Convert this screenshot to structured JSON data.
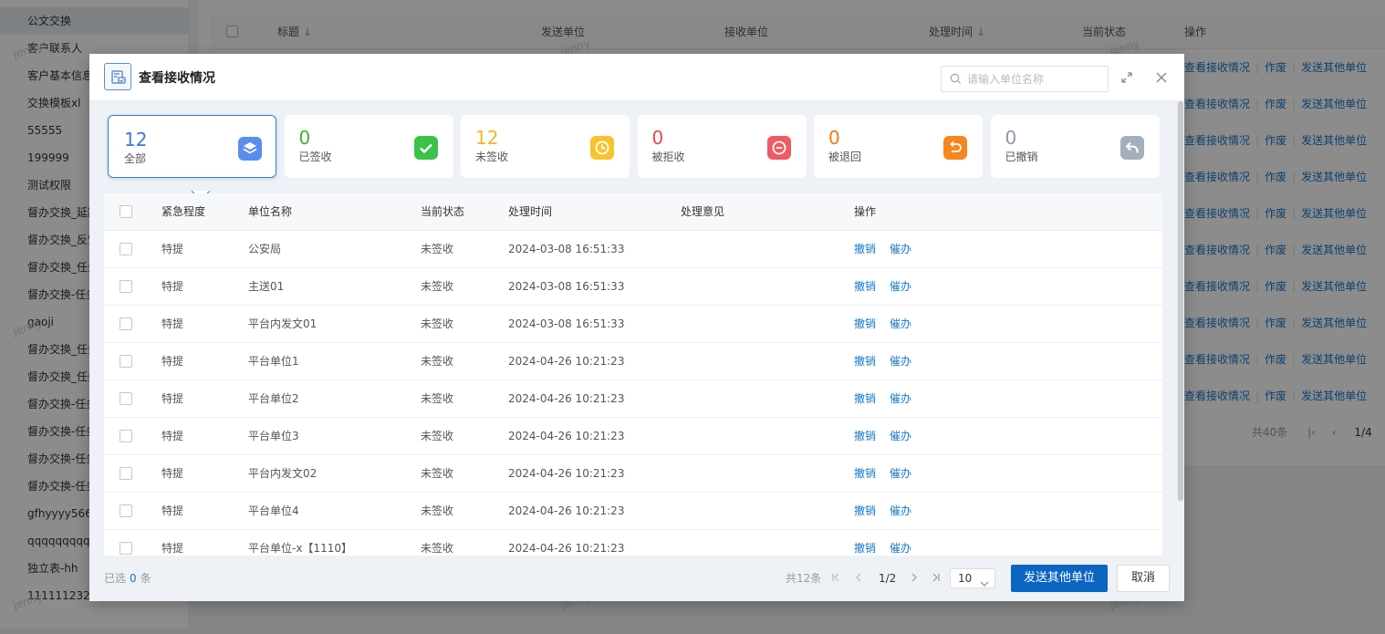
{
  "sidebar": {
    "items": [
      "公文交换",
      "客户联系人",
      "客户基本信息",
      "交换模板xl",
      "55555",
      "199999",
      "测试权限",
      "督办交换_延期",
      "督办交换_反馈",
      "督办交换_任务",
      "督办交换-任务",
      "gaoji",
      "督办交换_任务",
      "督办交换_任务",
      "督办交换-任务",
      "督办交换-任务",
      "督办交换-任务",
      "督办交换-任务",
      "gfhyyyy5666",
      "qqqqqqqqqqq",
      "独立表-hh",
      "11111123232"
    ]
  },
  "background_table": {
    "headers": {
      "title": "标题",
      "send_unit": "发送单位",
      "recv_unit": "接收单位",
      "time": "处理时间",
      "status": "当前状态",
      "ops": "操作"
    },
    "sort_arrow": "↓",
    "row_actions": [
      "查看接收情况",
      "作废",
      "发送其他单位"
    ],
    "row_count": 10,
    "pager": {
      "total": "共40条",
      "page": "1/4"
    }
  },
  "watermark": "jenny",
  "modal": {
    "title": "查看接收情况",
    "search_placeholder": "请输入单位名称",
    "cards": [
      {
        "count": "12",
        "label": "全部",
        "color": "#3a7bd5",
        "icon_color": "#5b8def",
        "icon": "layers-icon"
      },
      {
        "count": "0",
        "label": "已签收",
        "color": "#3cb526",
        "icon_color": "#3cc24a",
        "icon": "check-icon"
      },
      {
        "count": "12",
        "label": "未签收",
        "color": "#f5b622",
        "icon_color": "#f7c32e",
        "icon": "clock-icon"
      },
      {
        "count": "0",
        "label": "被拒收",
        "color": "#e8464f",
        "icon_color": "#ef5a63",
        "icon": "reject-icon"
      },
      {
        "count": "0",
        "label": "被退回",
        "color": "#f27a12",
        "icon_color": "#f5871f",
        "icon": "return-icon"
      },
      {
        "count": "0",
        "label": "已撤销",
        "color": "#8e98a8",
        "icon_color": "#a5aebb",
        "icon": "revoke-icon"
      }
    ],
    "table": {
      "headers": {
        "urgency": "紧急程度",
        "unit": "单位名称",
        "status": "当前状态",
        "time": "处理时间",
        "opinion": "处理意见",
        "ops": "操作"
      },
      "rows": [
        {
          "urgency": "特提",
          "unit": "公安局",
          "status": "未签收",
          "time": "2024-03-08 16:51:33",
          "opinion": ""
        },
        {
          "urgency": "特提",
          "unit": "主送01",
          "status": "未签收",
          "time": "2024-03-08 16:51:33",
          "opinion": ""
        },
        {
          "urgency": "特提",
          "unit": "平台内发文01",
          "status": "未签收",
          "time": "2024-03-08 16:51:33",
          "opinion": ""
        },
        {
          "urgency": "特提",
          "unit": "平台单位1",
          "status": "未签收",
          "time": "2024-04-26 10:21:23",
          "opinion": ""
        },
        {
          "urgency": "特提",
          "unit": "平台单位2",
          "status": "未签收",
          "time": "2024-04-26 10:21:23",
          "opinion": ""
        },
        {
          "urgency": "特提",
          "unit": "平台单位3",
          "status": "未签收",
          "time": "2024-04-26 10:21:23",
          "opinion": ""
        },
        {
          "urgency": "特提",
          "unit": "平台内发文02",
          "status": "未签收",
          "time": "2024-04-26 10:21:23",
          "opinion": ""
        },
        {
          "urgency": "特提",
          "unit": "平台单位4",
          "status": "未签收",
          "time": "2024-04-26 10:21:23",
          "opinion": ""
        },
        {
          "urgency": "特提",
          "unit": "平台单位-x【1110】",
          "status": "未签收",
          "time": "2024-04-26 10:21:23",
          "opinion": ""
        }
      ],
      "actions": {
        "revoke": "撤销",
        "urge": "催办"
      }
    },
    "footer": {
      "selected_prefix": "已选",
      "selected_count": "0",
      "selected_suffix": "条",
      "total": "共12条",
      "page": "1/2",
      "page_size": "10",
      "send_button": "发送其他单位",
      "cancel_button": "取消"
    }
  },
  "colors": {
    "primary": "#0b65c2",
    "link": "#1677c8"
  }
}
